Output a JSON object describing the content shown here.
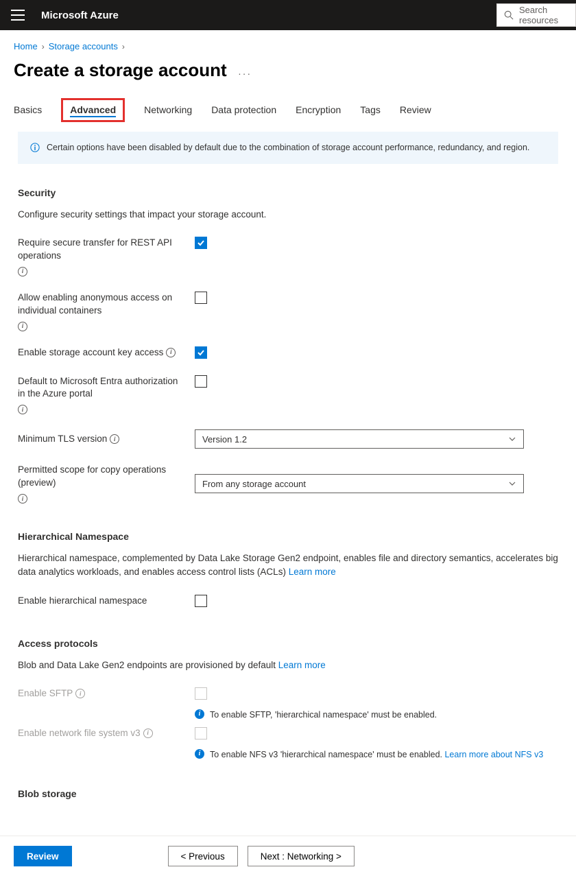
{
  "header": {
    "brand": "Microsoft Azure",
    "search_placeholder": "Search resources"
  },
  "breadcrumbs": {
    "home": "Home",
    "storage": "Storage accounts"
  },
  "title": "Create a storage account",
  "tabs": {
    "basics": "Basics",
    "advanced": "Advanced",
    "networking": "Networking",
    "dataprotection": "Data protection",
    "encryption": "Encryption",
    "tags": "Tags",
    "review": "Review"
  },
  "infobox": "Certain options have been disabled by default due to the combination of storage account performance, redundancy, and region.",
  "security": {
    "heading": "Security",
    "desc": "Configure security settings that impact your storage account.",
    "secure_transfer": "Require secure transfer for REST API operations",
    "anon_access": "Allow enabling anonymous access on individual containers",
    "key_access": "Enable storage account key access",
    "entra": "Default to Microsoft Entra authorization in the Azure portal",
    "tls_label": "Minimum TLS version",
    "tls_value": "Version 1.2",
    "copy_label": "Permitted scope for copy operations (preview)",
    "copy_value": "From any storage account"
  },
  "hns": {
    "heading": "Hierarchical Namespace",
    "desc": "Hierarchical namespace, complemented by Data Lake Storage Gen2 endpoint, enables file and directory semantics, accelerates big data analytics workloads, and enables access control lists (ACLs) ",
    "learn": "Learn more",
    "enable": "Enable hierarchical namespace"
  },
  "protocols": {
    "heading": "Access protocols",
    "desc": "Blob and Data Lake Gen2 endpoints are provisioned by default ",
    "learn": "Learn more",
    "sftp": "Enable SFTP",
    "sftp_hint": "To enable SFTP, 'hierarchical namespace' must be enabled.",
    "nfs": "Enable network file system v3",
    "nfs_hint": "To enable NFS v3 'hierarchical namespace' must be enabled. ",
    "nfs_link": "Learn more about NFS v3"
  },
  "blob": {
    "heading": "Blob storage"
  },
  "footer": {
    "review": "Review",
    "prev": "< Previous",
    "next": "Next : Networking >"
  }
}
